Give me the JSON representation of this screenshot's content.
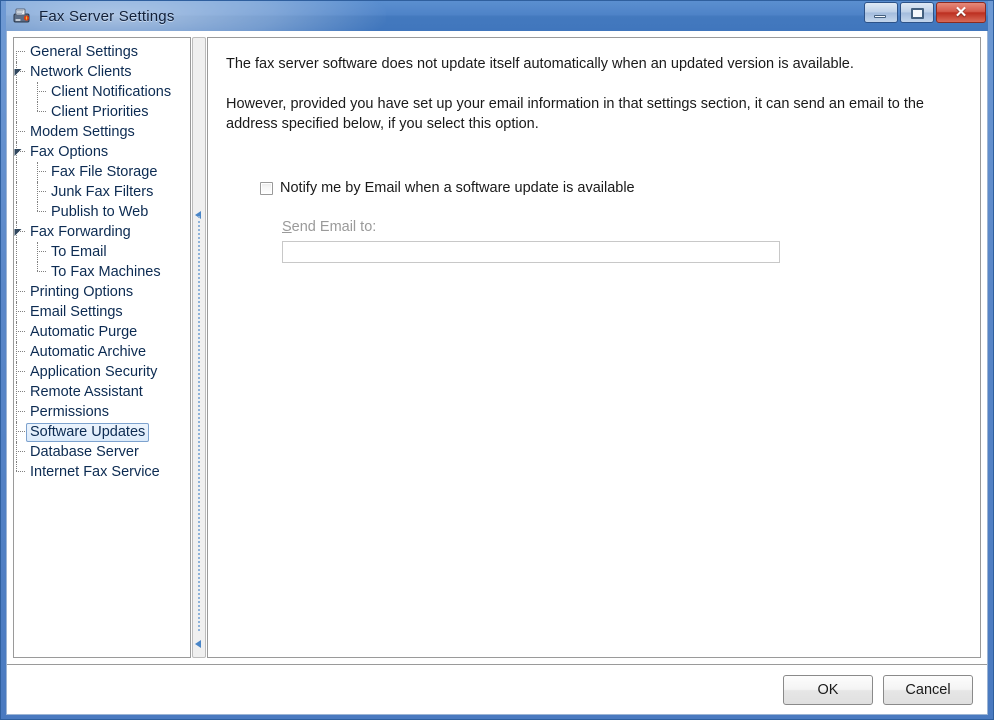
{
  "window": {
    "title": "Fax Server Settings",
    "icon": "fax-machine-icon",
    "controls": {
      "minimize": "minimize-icon",
      "maximize": "maximize-icon",
      "close_glyph": "✕"
    },
    "accent_title_color": "#4379be",
    "close_button_color": "#bc2f20"
  },
  "tree": {
    "selected": "Software Updates",
    "selection_fill": "#dcebfb",
    "selection_border": "#7da2ce",
    "nodes": [
      {
        "label": "General Settings",
        "level": 1,
        "expander": false
      },
      {
        "label": "Network Clients",
        "level": 1,
        "expander": true
      },
      {
        "label": "Client Notifications",
        "level": 2,
        "expander": false
      },
      {
        "label": "Client Priorities",
        "level": 2,
        "expander": false
      },
      {
        "label": "Modem Settings",
        "level": 1,
        "expander": false
      },
      {
        "label": "Fax Options",
        "level": 1,
        "expander": true
      },
      {
        "label": "Fax File Storage",
        "level": 2,
        "expander": false
      },
      {
        "label": "Junk Fax Filters",
        "level": 2,
        "expander": false
      },
      {
        "label": "Publish to Web",
        "level": 2,
        "expander": false
      },
      {
        "label": "Fax Forwarding",
        "level": 1,
        "expander": true
      },
      {
        "label": "To Email",
        "level": 2,
        "expander": false
      },
      {
        "label": "To Fax Machines",
        "level": 2,
        "expander": false
      },
      {
        "label": "Printing Options",
        "level": 1,
        "expander": false
      },
      {
        "label": "Email Settings",
        "level": 1,
        "expander": false
      },
      {
        "label": "Automatic Purge",
        "level": 1,
        "expander": false
      },
      {
        "label": "Automatic Archive",
        "level": 1,
        "expander": false
      },
      {
        "label": "Application Security",
        "level": 1,
        "expander": false
      },
      {
        "label": "Remote Assistant",
        "level": 1,
        "expander": false
      },
      {
        "label": "Permissions",
        "level": 1,
        "expander": false
      },
      {
        "label": "Software Updates",
        "level": 1,
        "expander": false
      },
      {
        "label": "Database Server",
        "level": 1,
        "expander": false
      },
      {
        "label": "Internet Fax Service",
        "level": 1,
        "expander": false
      }
    ]
  },
  "splitter": {
    "name": "pane-splitter",
    "arrow_color": "#4a86c8"
  },
  "content": {
    "paragraph1": "The fax server software does not update itself automatically when an updated version is available.",
    "paragraph2": "However, provided you have set up your email information in that settings section, it can send an email to the address specified below, if you select this option.",
    "notify_checkbox": {
      "label": "Notify me by Email when a software update is available",
      "checked": false
    },
    "email_field": {
      "label_prefix": "S",
      "label_rest": "end Email to:",
      "value": "",
      "placeholder": "",
      "disabled": true,
      "disabled_label_color": "#9a9a9a"
    }
  },
  "footer": {
    "ok_label": "OK",
    "cancel_label": "Cancel"
  }
}
